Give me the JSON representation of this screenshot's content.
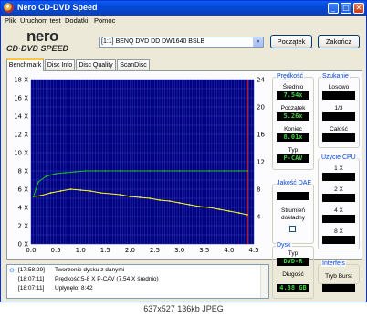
{
  "window": {
    "title": "Nero CD-DVD Speed",
    "controls": {
      "minimize": "_",
      "maximize": "□",
      "close": "✕"
    }
  },
  "menu": [
    "Plik",
    "Uruchom test",
    "Dodatki",
    "Pomoc"
  ],
  "logo": {
    "nero": "nero",
    "subtitle": "CD·DVD SPEED"
  },
  "drive": {
    "selected": "[1:1]  BENQ DVD DD DW1640 BSLB"
  },
  "buttons": {
    "start": "Początek",
    "exit": "Zakończ"
  },
  "tabs": [
    "Benchmark",
    "Disc Info",
    "Disc Quality",
    "ScanDisc"
  ],
  "active_tab": "Benchmark",
  "chart_data": {
    "type": "line",
    "x_range": [
      0,
      4.5
    ],
    "x_ticks": [
      "0.0",
      "0.5",
      "1.0",
      "1.5",
      "2.0",
      "2.5",
      "3.0",
      "3.5",
      "4.0",
      "4.5"
    ],
    "y_left_range": [
      0,
      18
    ],
    "y_left_ticks": [
      "18 X",
      "16 X",
      "14 X",
      "12 X",
      "10 X",
      "8 X",
      "6 X",
      "4 X",
      "2 X",
      "0 X"
    ],
    "y_right_range": [
      0,
      24
    ],
    "y_right_ticks": [
      "24",
      "20",
      "16",
      "12",
      "8",
      "4"
    ],
    "grid": true,
    "background": "#000080",
    "end_marker_x": 4.38,
    "series": [
      {
        "color": "#ffff20",
        "x": [
          0.05,
          0.2,
          0.4,
          0.6,
          0.8,
          1.0,
          1.2,
          1.4,
          1.6,
          1.8,
          2.0,
          2.2,
          2.4,
          2.6,
          2.8,
          3.0,
          3.2,
          3.4,
          3.6,
          3.8,
          4.0,
          4.2,
          4.37
        ],
        "y": [
          5.2,
          5.3,
          5.6,
          5.8,
          6.0,
          5.9,
          5.8,
          5.6,
          5.5,
          5.4,
          5.2,
          5.1,
          5.0,
          4.8,
          4.7,
          4.5,
          4.3,
          4.1,
          4.0,
          3.8,
          3.6,
          3.4,
          3.2
        ]
      },
      {
        "color": "#20c020",
        "x": [
          0.05,
          0.1,
          0.15,
          0.3,
          0.5,
          0.7,
          0.9,
          1.1,
          1.3,
          1.5,
          1.8,
          2.1,
          2.4,
          2.7,
          3.0,
          3.3,
          3.6,
          3.9,
          4.2,
          4.37
        ],
        "y": [
          5.2,
          6.0,
          6.8,
          7.4,
          7.7,
          7.8,
          7.9,
          8.0,
          8.0,
          8.0,
          8.0,
          8.0,
          8.0,
          8.0,
          8.0,
          8.0,
          8.0,
          8.0,
          8.0,
          8.0
        ]
      }
    ]
  },
  "speed_group": {
    "title": "Prędkość",
    "average_label": "Średnio",
    "average_value": "7.54x",
    "start_label": "Początek",
    "start_value": "5.26x",
    "end_label": "Koniec",
    "end_value": "8.01x",
    "type_label": "Typ",
    "type_value": "P-CAV"
  },
  "dae_group": {
    "title": "Jakość DAE",
    "value": "",
    "accurate_stream_label": "Strumień dokładny"
  },
  "disc_group": {
    "title": "Dysk",
    "type_label": "Typ",
    "type_value": "DVD-R",
    "length_label": "Długość",
    "length_value": "4.38 GB"
  },
  "seek_group": {
    "title": "Szukanie",
    "random_label": "Losowo",
    "third_label": "1/3",
    "full_label": "Całość"
  },
  "cpu_group": {
    "title": "Użycie CPU",
    "x1": "1 X",
    "x2": "2 X",
    "x4": "4 X",
    "x8": "8 X"
  },
  "interface_group": {
    "title": "Interfejs",
    "burst_label": "Tryb Burst"
  },
  "log": [
    {
      "time": "[17:58:29]",
      "text": "Tworzenie dysku z danymi"
    },
    {
      "time": "[18:07:11]",
      "text": "Prędkość:5-8 X P-CAV (7.54 X średnio)"
    },
    {
      "time": "[18:07:11]",
      "text": "Upłynęło:  8:42"
    }
  ],
  "caption": "637x527  136kb  JPEG"
}
